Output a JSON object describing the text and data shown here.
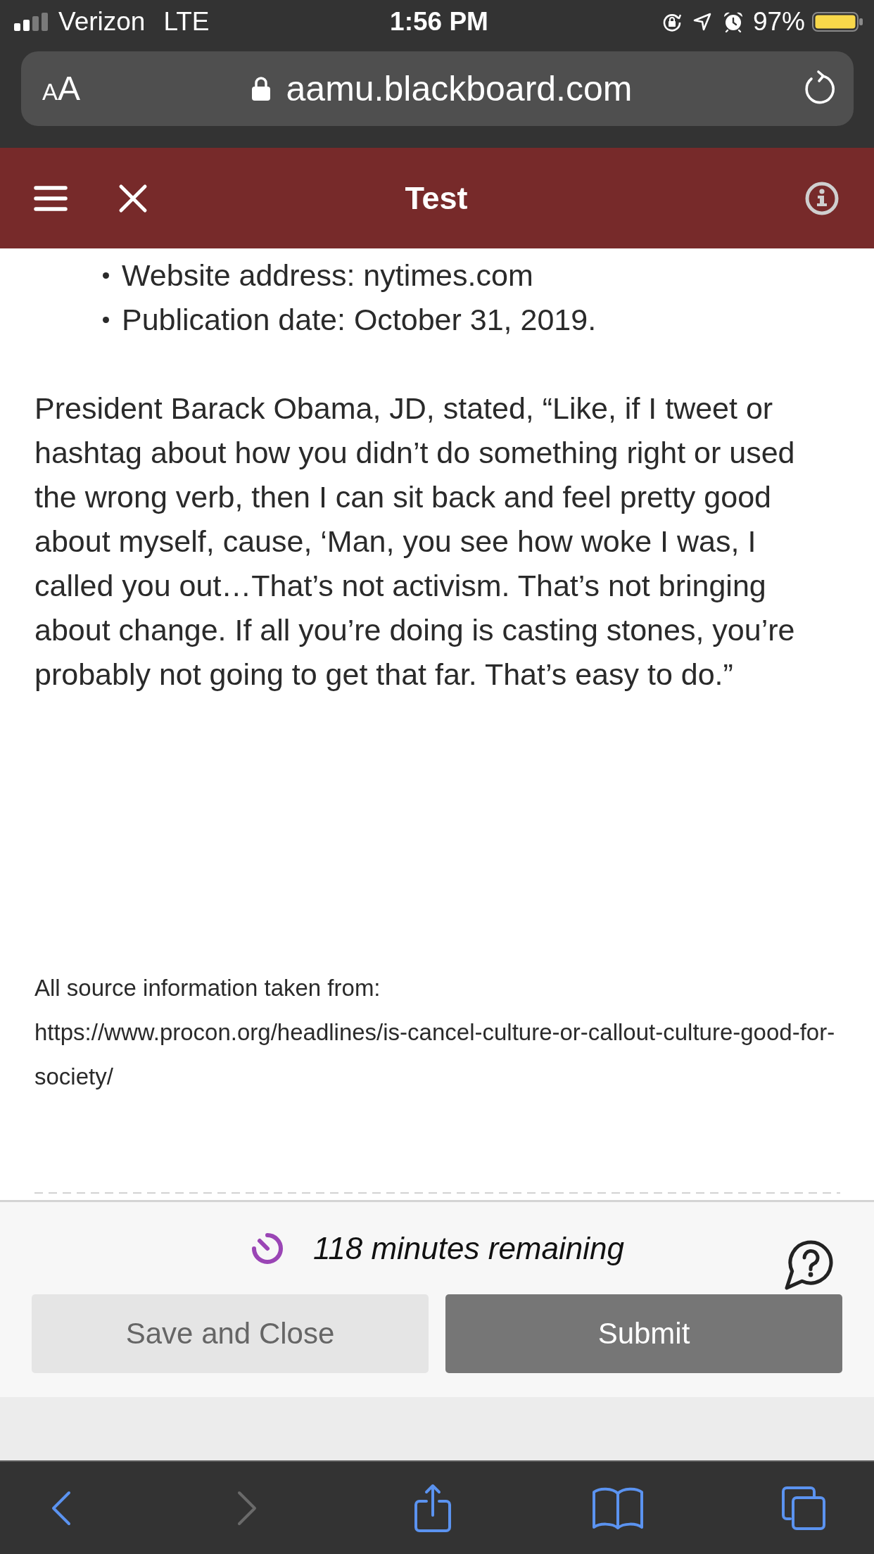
{
  "status_bar": {
    "carrier": "Verizon",
    "network": "LTE",
    "time": "1:56 PM",
    "battery": "97%"
  },
  "address_bar": {
    "text_size": "AA",
    "url": "aamu.blackboard.com"
  },
  "header": {
    "title": "Test"
  },
  "content": {
    "bullets": [
      "Website address: nytimes.com",
      "Publication date: October 31, 2019."
    ],
    "paragraph": "President Barack Obama, JD, stated, “Like, if I tweet or hashtag about how you didn’t do something right or used the wrong verb, then I can sit back and feel pretty good about myself, cause, ‘Man, you see how woke I was, I called you out…That’s not activism. That’s not bringing about change. If all you’re doing is casting stones, you’re probably not going to get that far. That’s easy to do.”",
    "source_label": "All source information taken from:",
    "source_url": "https://www.procon.org/headlines/is-cancel-culture-or-callout-culture-good-for-society/"
  },
  "footer": {
    "timer": "118 minutes remaining",
    "buttons": [
      {
        "label": "Save and Close",
        "kind": "save"
      },
      {
        "label": "Submit",
        "kind": "submit"
      }
    ]
  },
  "toolbar": [
    {
      "kind": "back",
      "disabled": false
    },
    {
      "kind": "forward",
      "disabled": true
    },
    {
      "kind": "share",
      "disabled": false
    },
    {
      "kind": "bookmarks",
      "disabled": false
    },
    {
      "kind": "tabs",
      "disabled": false
    }
  ]
}
